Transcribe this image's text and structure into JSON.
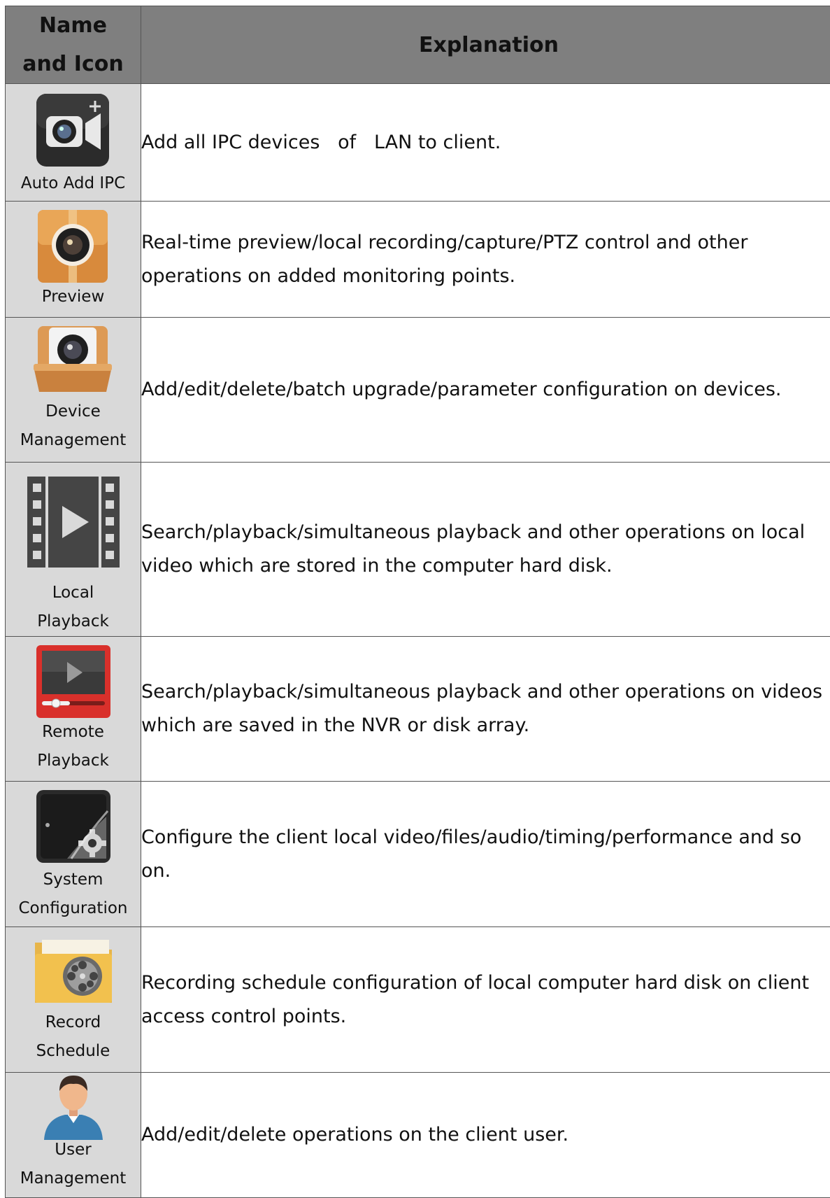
{
  "header": {
    "name_and_icon": "Name\nand Icon",
    "name_line1": "Name",
    "name_line2": "and Icon",
    "explanation": "Explanation"
  },
  "rows": [
    {
      "icon": "add-camera-icon",
      "name_lines": [
        "Auto Add IPC"
      ],
      "explanation": "Add all IPC devices   of   LAN to client."
    },
    {
      "icon": "camera-box-icon",
      "name_lines": [
        "Preview"
      ],
      "explanation": "Real-time preview/local recording/capture/PTZ control and other operations on added monitoring points."
    },
    {
      "icon": "camera-tray-icon",
      "name_lines": [
        "Device",
        "Management"
      ],
      "explanation": "Add/edit/delete/batch upgrade/parameter configuration on devices."
    },
    {
      "icon": "film-play-icon",
      "name_lines": [
        "Local",
        "Playback"
      ],
      "explanation": "Search/playback/simultaneous playback and other operations on local video which are stored in the computer hard disk."
    },
    {
      "icon": "remote-play-icon",
      "name_lines": [
        "Remote",
        "Playback"
      ],
      "explanation": "Search/playback/simultaneous playback and other operations on videos which are saved in the NVR or disk array."
    },
    {
      "icon": "gear-tablet-icon",
      "name_lines": [
        "System",
        "Configuration"
      ],
      "explanation": "Configure the client local video/files/audio/timing/performance and so on."
    },
    {
      "icon": "film-reel-folder-icon",
      "name_lines": [
        "Record",
        "Schedule"
      ],
      "explanation": "Recording schedule configuration of local computer hard disk on client access control points."
    },
    {
      "icon": "user-icon",
      "name_lines": [
        "User",
        "Management"
      ],
      "explanation": "Add/edit/delete operations on the client user."
    }
  ]
}
